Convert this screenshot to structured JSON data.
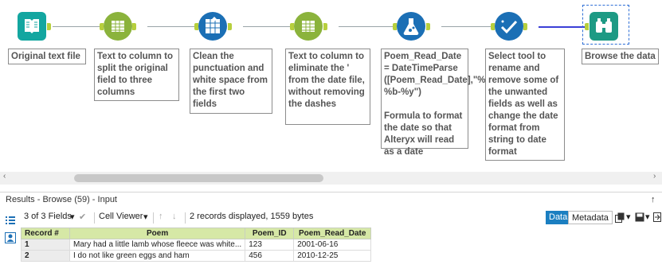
{
  "canvas": {
    "tools": [
      {
        "name": "input-tool",
        "comment": "Original text file"
      },
      {
        "name": "text-to-columns-tool-1",
        "comment": "Text to column to split the original field to three columns"
      },
      {
        "name": "data-cleansing-tool",
        "comment": "Clean the punctuation and white space from the first two fields"
      },
      {
        "name": "text-to-columns-tool-2",
        "comment": "Text to column to eliminate the ' from the date file, without removing the dashes"
      },
      {
        "name": "datetime-tool",
        "comment": "Poem_Read_Date = DateTimeParse ([Poem_Read_Date],\"%d-%b-%y\")\n\nFormula to format the date so that Alteryx will read as a date"
      },
      {
        "name": "select-tool",
        "comment": "Select tool to rename and remove some of the unwanted fields as well as change the date format from string to date format"
      },
      {
        "name": "browse-tool",
        "comment": "Browse the data"
      }
    ],
    "colors": {
      "input": "#13a6a0",
      "preparation": "#8bb33c",
      "parse": "#1b6fb5",
      "select": "#1b6fb5",
      "browse": "#1d9a84",
      "anchor": "#b7cf3d"
    }
  },
  "results": {
    "title": "Results - Browse (59) - Input",
    "pin_icon": "↑",
    "toolbar": {
      "fields": "3 of 3 Fields",
      "dropdown": "▾",
      "check": "✔",
      "viewer": "Cell Viewer",
      "up": "↑",
      "down": "↓",
      "summary": "2 records displayed, 1559 bytes",
      "data_tab": "Data",
      "metadata_tab": "Metadata"
    },
    "table": {
      "headers": [
        "Record #",
        "Poem",
        "Poem_ID",
        "Poem_Read_Date"
      ],
      "rows": [
        [
          "1",
          "Mary had a little lamb whose fleece was white...",
          "123",
          "2001-06-16"
        ],
        [
          "2",
          "I do not like green eggs and ham",
          "456",
          "2010-12-25"
        ]
      ]
    }
  }
}
